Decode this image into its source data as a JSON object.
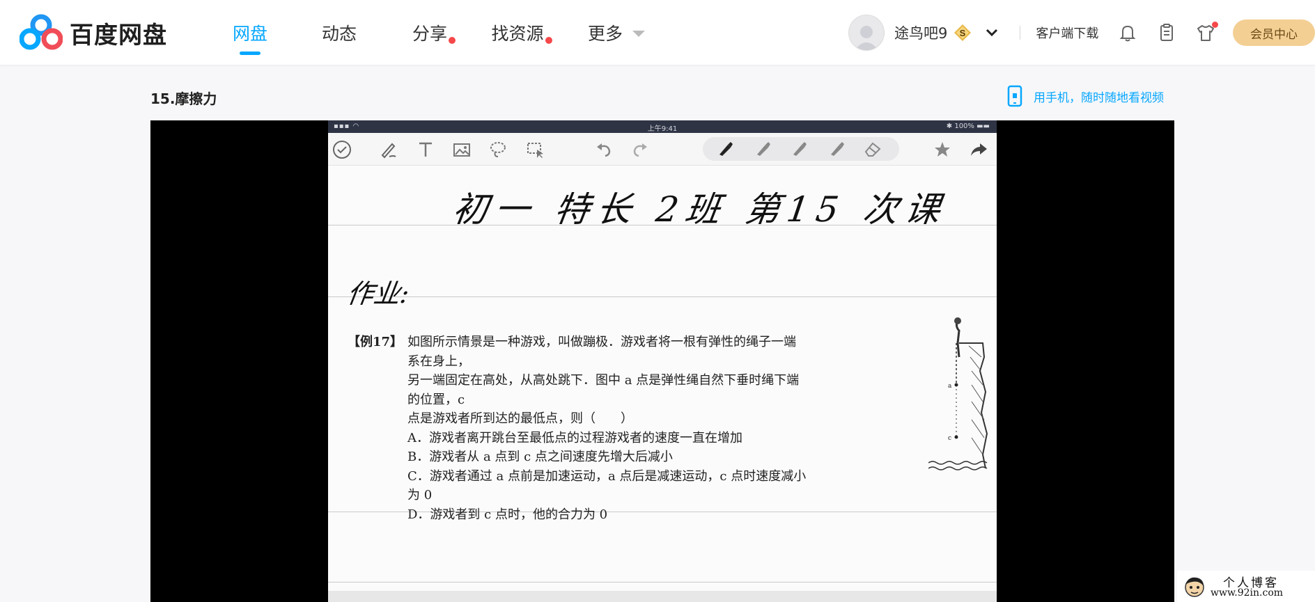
{
  "header": {
    "logo_text": "百度网盘",
    "nav": [
      {
        "label": "网盘",
        "active": true,
        "badge": false
      },
      {
        "label": "动态",
        "active": false,
        "badge": false
      },
      {
        "label": "分享",
        "active": false,
        "badge": true
      },
      {
        "label": "找资源",
        "active": false,
        "badge": true
      },
      {
        "label": "更多",
        "active": false,
        "badge": false
      }
    ],
    "username": "途鸟吧9",
    "svip_badge": "S",
    "client_download": "客户端下载",
    "vip_center": "会员中心",
    "accent_color": "#06a7ff",
    "badge_color": "#f5484a",
    "vip_color": "#f3cf93",
    "icons": [
      "bell-icon",
      "clipboard-icon",
      "tshirt-icon"
    ]
  },
  "file": {
    "title": "15.摩擦力",
    "phone_link": "用手机，随时随地看视频"
  },
  "video": {
    "status_time": "上午9:41",
    "status_battery": "100%",
    "handwritten_title": "初一 特长 2班 第15 次课",
    "handwritten_homework": "作业:",
    "problem_tag": "【例17】",
    "problem_lines": [
      "如图所示情景是一种游戏，叫做蹦极．游戏者将一根有弹性的绳子一端系在身上，",
      "另一端固定在高处，从高处跳下．图中 a 点是弹性绳自然下垂时绳下端的位置，c",
      "点是游戏者所到达的最低点，则（　　）"
    ],
    "options": [
      "A．游戏者离开跳台至最低点的过程游戏者的速度一直在增加",
      "B．游戏者从 a 点到 c 点之间速度先增大后减小",
      "C．游戏者通过 a 点前是加速运动，a 点后是减速运动，c 点时速度减小为 0",
      "D．游戏者到 c 点时，他的合力为 0"
    ],
    "figure_labels": [
      "a",
      "c"
    ]
  },
  "watermark": {
    "title": "个人博客",
    "url": "www.92in.com"
  }
}
